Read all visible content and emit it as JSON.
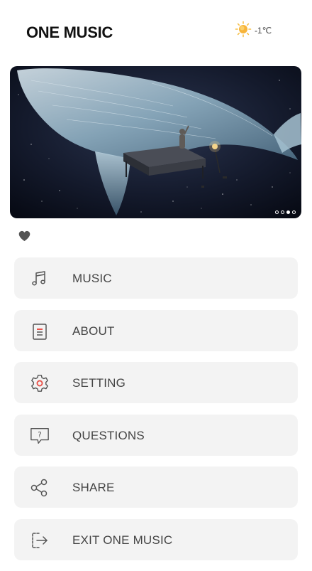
{
  "header": {
    "title": "ONE MUSIC",
    "weather": {
      "icon": "sun-icon",
      "temperature": "-1℃",
      "icon_color": "#f5b63a"
    }
  },
  "banner": {
    "pager": {
      "total": 4,
      "active_index": 3
    }
  },
  "like": {
    "icon": "heart-icon",
    "color": "#555555"
  },
  "menu": {
    "items": [
      {
        "label": "MUSIC",
        "icon": "music-note-icon"
      },
      {
        "label": "ABOUT",
        "icon": "document-icon"
      },
      {
        "label": "SETTING",
        "icon": "gear-icon"
      },
      {
        "label": "QUESTIONS",
        "icon": "question-bubble-icon"
      },
      {
        "label": "SHARE",
        "icon": "share-icon"
      },
      {
        "label": "EXIT ONE MUSIC",
        "icon": "exit-icon"
      }
    ]
  },
  "colors": {
    "menu_background": "#f3f3f3",
    "accent_red": "#e8524a",
    "icon_gray": "#555555"
  }
}
